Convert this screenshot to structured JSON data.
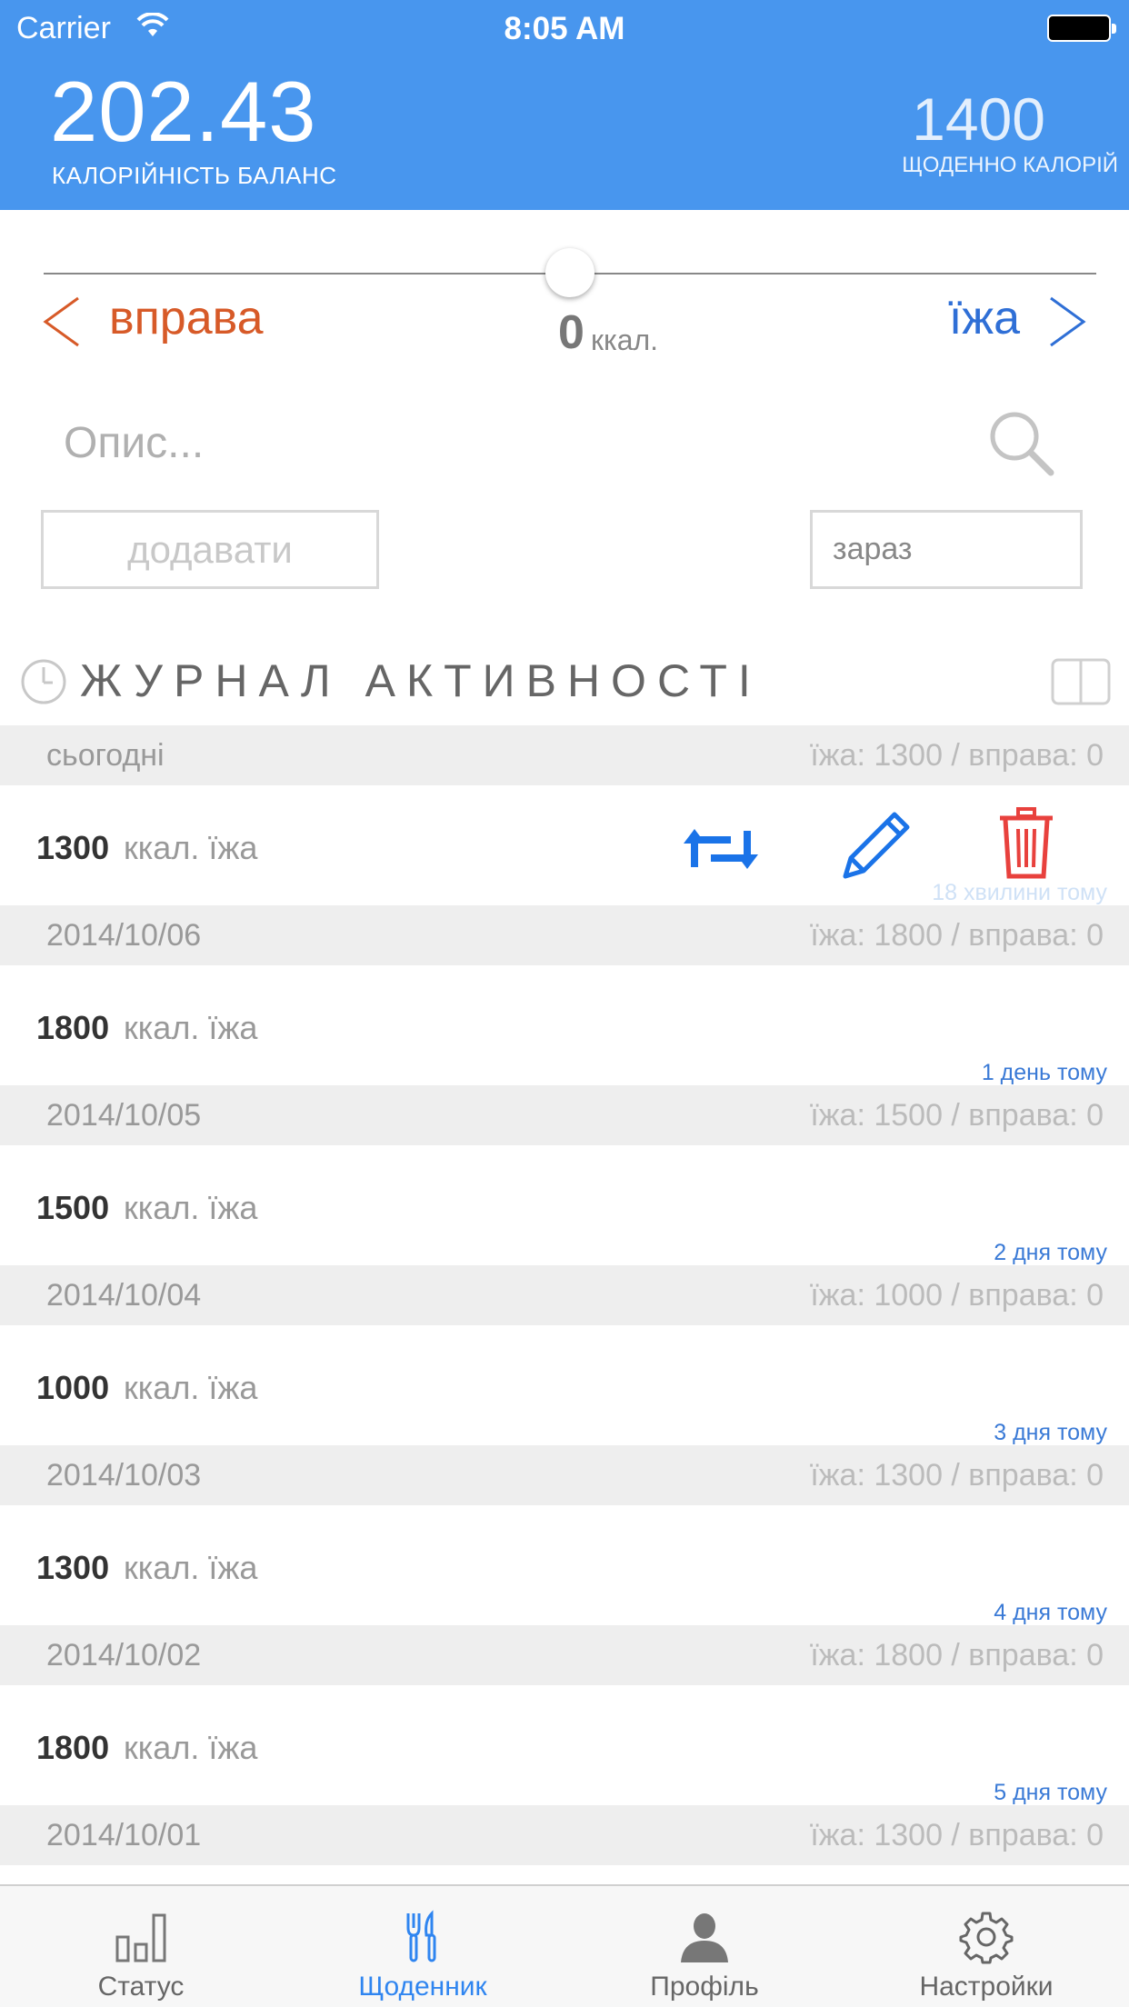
{
  "status_bar": {
    "carrier": "Carrier",
    "time": "8:05 AM"
  },
  "header": {
    "balance_value": "202.43",
    "balance_label": "КАЛОРІЙНІСТЬ БАЛАНС",
    "daily_value": "1400",
    "daily_label": "ЩОДЕННО КАЛОРІЙ"
  },
  "slider": {
    "left_label": "вправа",
    "right_label": "їжа",
    "value": "0",
    "unit": "ккал."
  },
  "search": {
    "placeholder": "Опис..."
  },
  "buttons": {
    "add": "додавати",
    "time": "зараз"
  },
  "log": {
    "title": "ЖУРНАЛ АКТИВНОСТІ"
  },
  "days": [
    {
      "date": "сьогодні",
      "totals": "їжа: 1300 / вправа: 0",
      "amount": "1300",
      "unit": "ккал. їжа",
      "ago": "18 хвилини тому"
    },
    {
      "date": "2014/10/06",
      "totals": "їжа: 1800 / вправа: 0",
      "amount": "1800",
      "unit": "ккал. їжа",
      "ago": "1 день тому"
    },
    {
      "date": "2014/10/05",
      "totals": "їжа: 1500 / вправа: 0",
      "amount": "1500",
      "unit": "ккал. їжа",
      "ago": "2 дня тому"
    },
    {
      "date": "2014/10/04",
      "totals": "їжа: 1000 / вправа: 0",
      "amount": "1000",
      "unit": "ккал. їжа",
      "ago": "3 дня тому"
    },
    {
      "date": "2014/10/03",
      "totals": "їжа: 1300 / вправа: 0",
      "amount": "1300",
      "unit": "ккал. їжа",
      "ago": "4 дня тому"
    },
    {
      "date": "2014/10/02",
      "totals": "їжа: 1800 / вправа: 0",
      "amount": "1800",
      "unit": "ккал. їжа",
      "ago": "5 дня тому"
    },
    {
      "date": "2014/10/01",
      "totals": "їжа: 1300 / вправа: 0"
    }
  ],
  "tabs": [
    {
      "label": "Статус",
      "icon": "bar-chart-icon"
    },
    {
      "label": "Щоденник",
      "icon": "fork-knife-icon"
    },
    {
      "label": "Профіль",
      "icon": "person-icon"
    },
    {
      "label": "Настройки",
      "icon": "gear-icon"
    }
  ],
  "colors": {
    "header_bg": "#4896ee",
    "exercise": "#d75a28",
    "food": "#2f6fd6",
    "delete": "#e8413d",
    "active_tab": "#2f85f0"
  }
}
